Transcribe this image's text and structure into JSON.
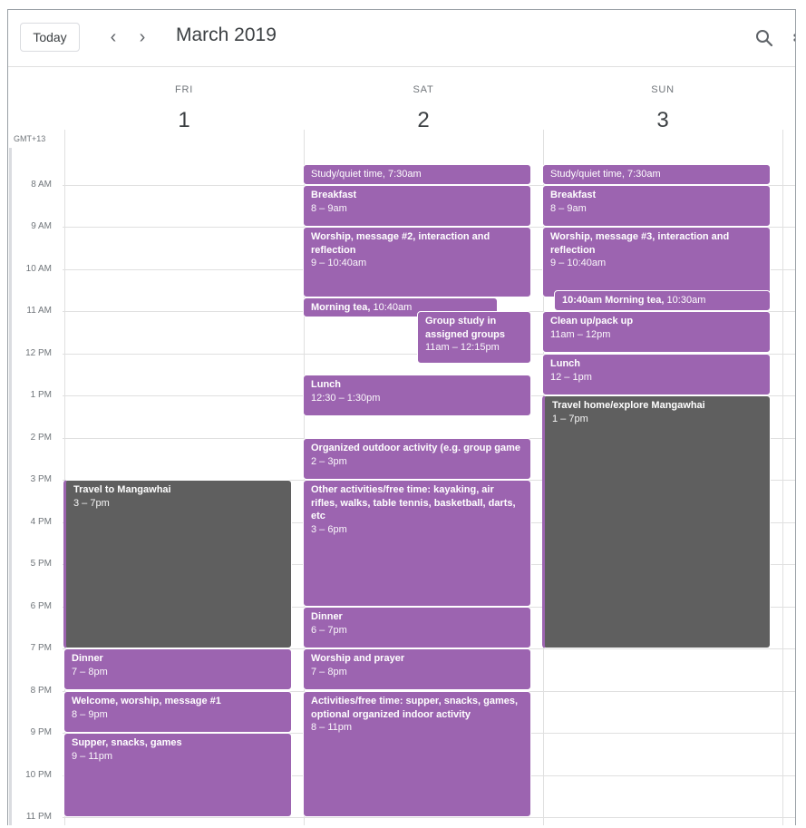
{
  "toolbar": {
    "today_label": "Today",
    "prev_icon": "‹",
    "next_icon": "›",
    "title": "March 2019"
  },
  "timezone": "GMT+13",
  "days": [
    {
      "name": "FRI",
      "num": "1"
    },
    {
      "name": "SAT",
      "num": "2"
    },
    {
      "name": "SUN",
      "num": "3"
    }
  ],
  "hours": [
    "8 AM",
    "9 AM",
    "10 AM",
    "11 AM",
    "12 PM",
    "1 PM",
    "2 PM",
    "3 PM",
    "4 PM",
    "5 PM",
    "6 PM",
    "7 PM",
    "8 PM",
    "9 PM",
    "10 PM",
    "11 PM"
  ],
  "events": {
    "fri": [
      {
        "title": "Travel to Mangawhai",
        "time": "3 – 7pm"
      },
      {
        "title": "Dinner",
        "time": "7 – 8pm"
      },
      {
        "title": "Welcome, worship, message #1",
        "time": "8 – 9pm"
      },
      {
        "title": "Supper, snacks, games",
        "time": "9 – 11pm"
      }
    ],
    "sat": [
      {
        "title": "Study/quiet time,",
        "time": "7:30am"
      },
      {
        "title": "Breakfast",
        "time": "8 – 9am"
      },
      {
        "title": "Worship, message #2, interaction and reflection",
        "time": "9 – 10:40am"
      },
      {
        "title": "Morning tea,",
        "time": "10:40am"
      },
      {
        "title": "Group study in assigned groups",
        "time": "11am – 12:15pm"
      },
      {
        "title": "Lunch",
        "time": "12:30 – 1:30pm"
      },
      {
        "title": "Organized outdoor activity (e.g. group game",
        "time": "2 – 3pm"
      },
      {
        "title": "Other activities/free time: kayaking, air rifles, walks, table tennis, basketball, darts, etc",
        "time": "3 – 6pm"
      },
      {
        "title": "Dinner",
        "time": "6 – 7pm"
      },
      {
        "title": "Worship and prayer",
        "time": "7 – 8pm"
      },
      {
        "title": "Activities/free time: supper, snacks, games, optional organized indoor activity",
        "time": "8 – 11pm"
      }
    ],
    "sun": [
      {
        "title": "Study/quiet time,",
        "time": "7:30am"
      },
      {
        "title": "Breakfast",
        "time": "8 – 9am"
      },
      {
        "title": "Worship, message #3, interaction and reflection",
        "time": "9 – 10:40am"
      },
      {
        "title": "10:40am Morning tea,",
        "time": "10:30am"
      },
      {
        "title": "Clean up/pack up",
        "time": "11am – 12pm"
      },
      {
        "title": "Lunch",
        "time": "12 – 1pm"
      },
      {
        "title": "Travel home/explore Mangawhai",
        "time": "1 – 7pm"
      }
    ]
  },
  "colors": {
    "event": "#9c64b0",
    "travel": "#5f5f5f"
  }
}
